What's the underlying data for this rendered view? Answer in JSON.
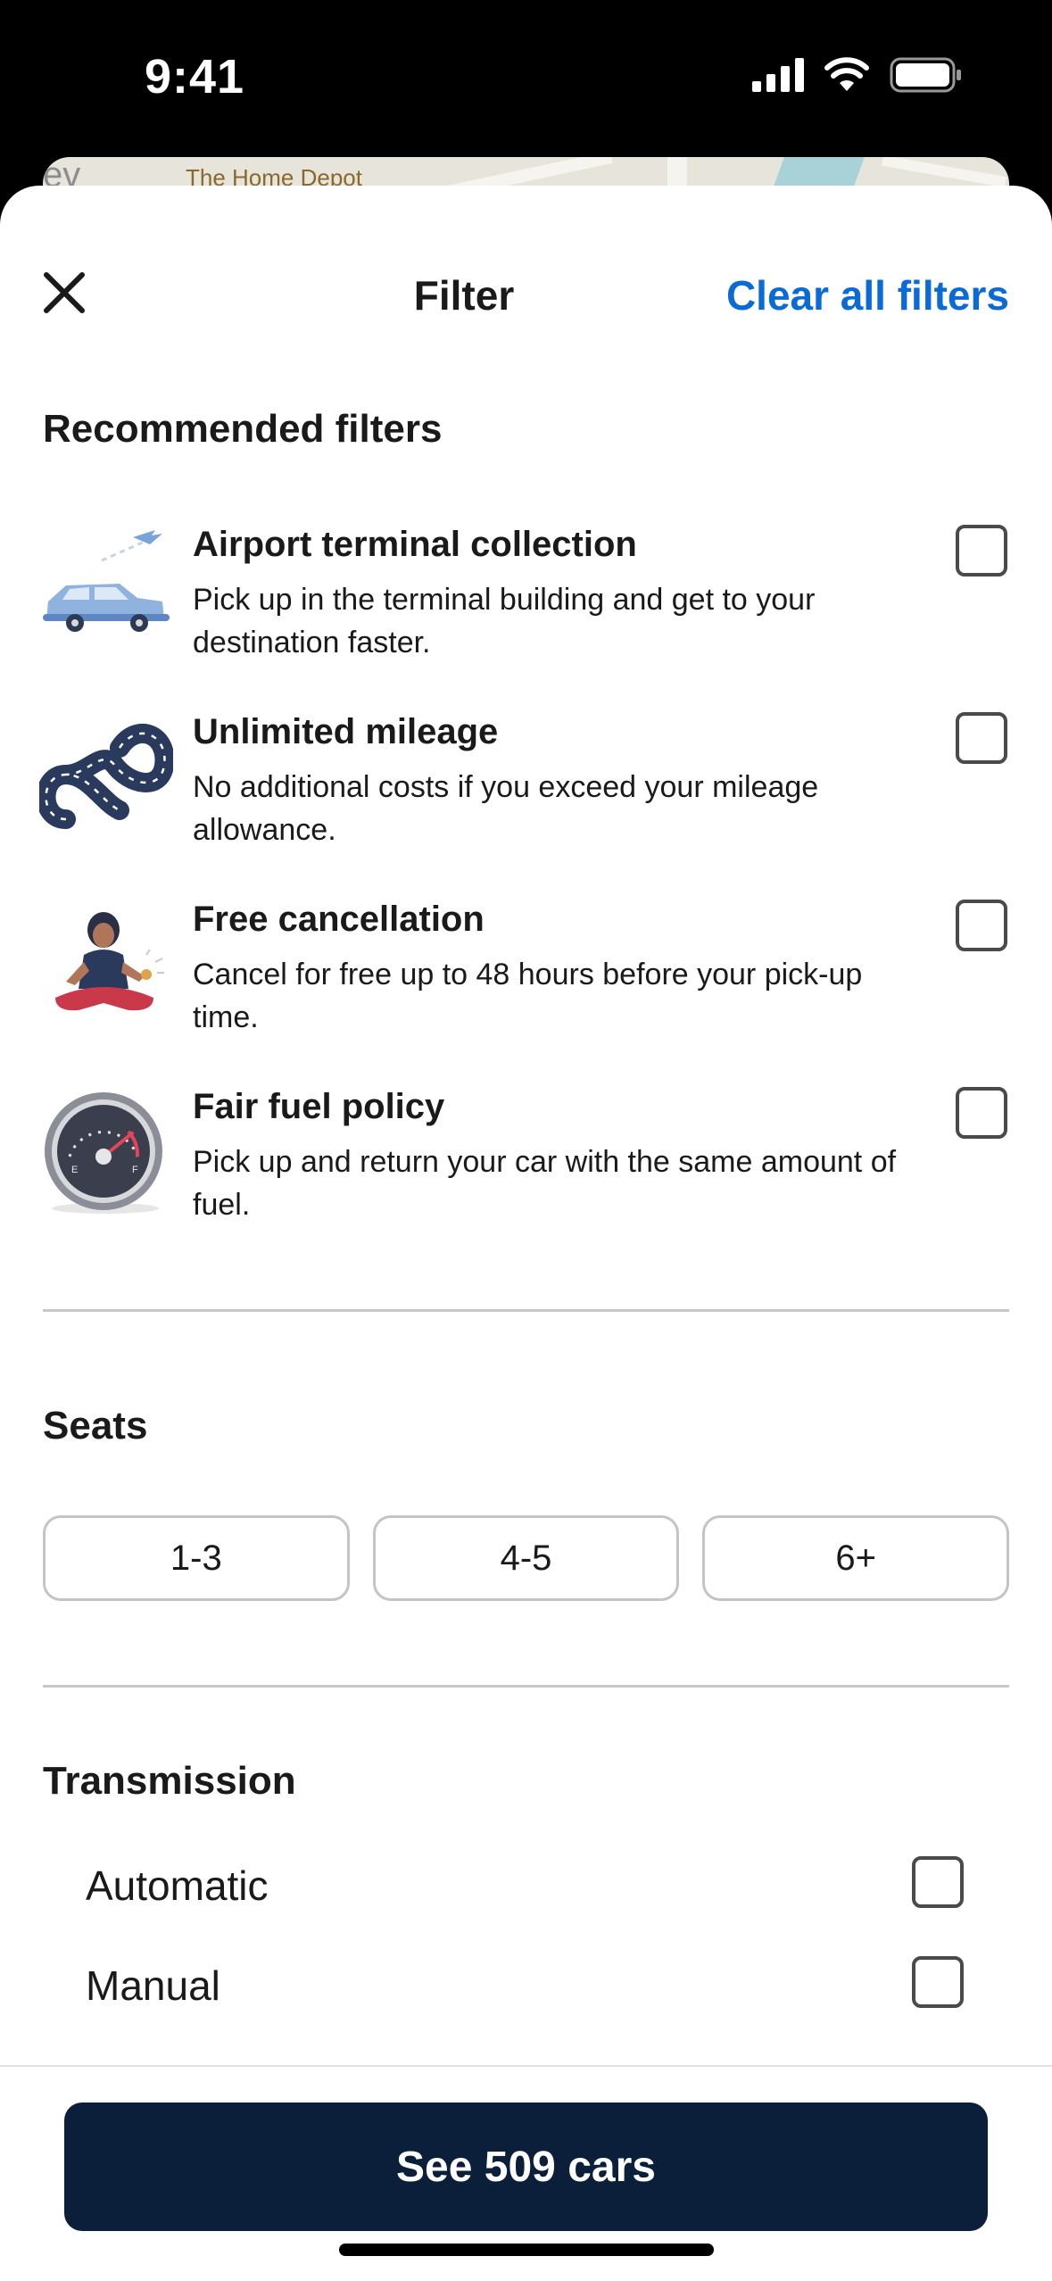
{
  "status_bar": {
    "time": "9:41",
    "icons": [
      "signal-icon",
      "wifi-icon",
      "battery-icon"
    ]
  },
  "map_peek": {
    "label_left": "ev",
    "label_store": "The Home Depot"
  },
  "header": {
    "title": "Filter",
    "clear_all_label": "Clear all filters",
    "close_icon": "close-icon"
  },
  "recommended": {
    "title": "Recommended filters",
    "items": [
      {
        "title": "Airport terminal collection",
        "description": "Pick up in the terminal building and get to your destination faster.",
        "illustration": "airport-car-illustration",
        "checked": false
      },
      {
        "title": "Unlimited mileage",
        "description": "No additional costs if you exceed your mileage allowance.",
        "illustration": "infinity-road-illustration",
        "checked": false
      },
      {
        "title": "Free cancellation",
        "description": "Cancel for free up to 48 hours before your pick-up time.",
        "illustration": "meditating-person-illustration",
        "checked": false
      },
      {
        "title": "Fair fuel policy",
        "description": "Pick up and return your car with the same amount of fuel.",
        "illustration": "fuel-gauge-illustration",
        "checked": false
      }
    ]
  },
  "seats": {
    "title": "Seats",
    "options": [
      "1-3",
      "4-5",
      "6+"
    ]
  },
  "transmission": {
    "title": "Transmission",
    "options": [
      {
        "label": "Automatic",
        "checked": false
      },
      {
        "label": "Manual",
        "checked": false
      }
    ]
  },
  "footer": {
    "cta_label": "See 509 cars"
  },
  "colors": {
    "accent": "#0a6bd6",
    "cta_bg": "#0b1f3a"
  }
}
